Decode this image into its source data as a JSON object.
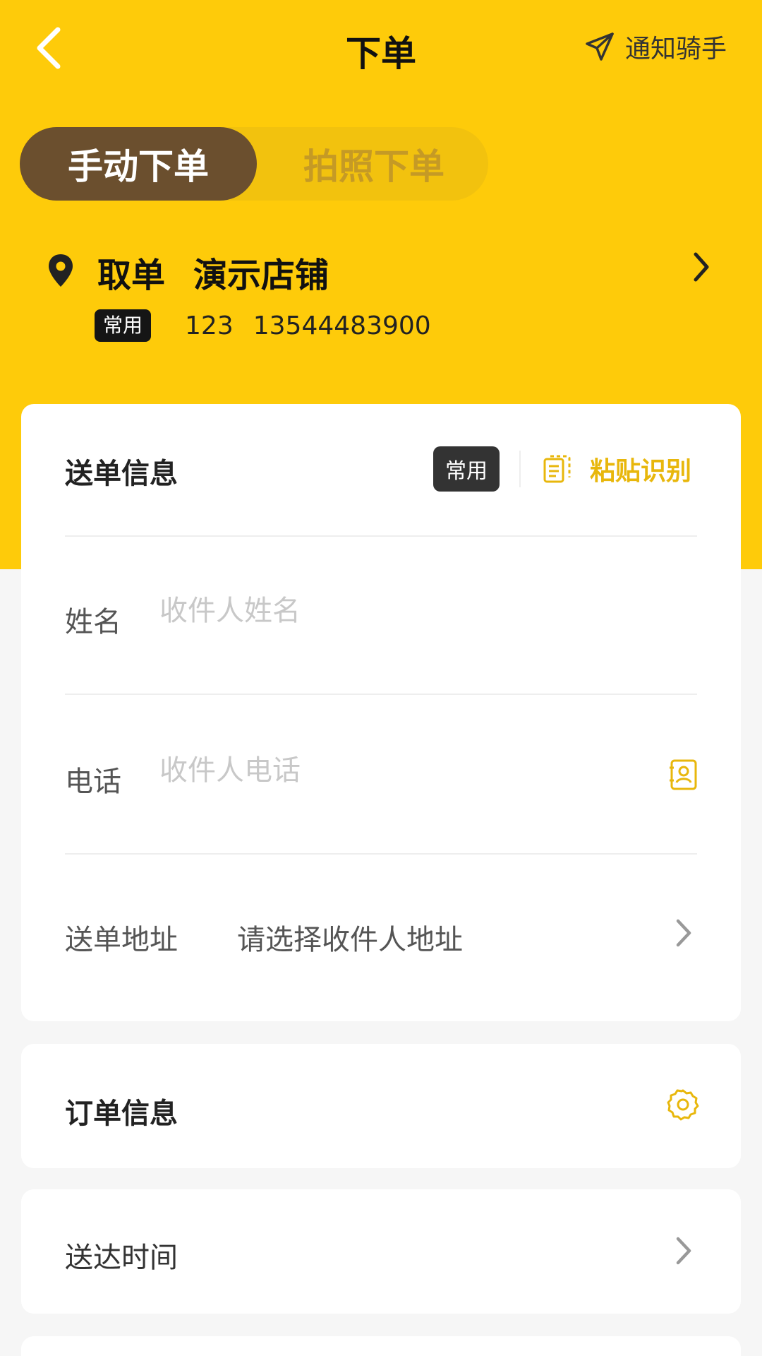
{
  "header": {
    "title": "下单",
    "notify_label": "通知骑手"
  },
  "mode_tabs": [
    {
      "label": "手动下单",
      "active": true
    },
    {
      "label": "拍照下单",
      "active": false
    }
  ],
  "pickup": {
    "type_label": "取单",
    "store_name": "演示店铺",
    "tag": "常用",
    "contact_name": "123",
    "phone": "13544483900"
  },
  "delivery": {
    "section_title": "送单信息",
    "common_tag": "常用",
    "paste_label": "粘贴识别",
    "name_label": "姓名",
    "name_placeholder": "收件人姓名",
    "phone_label": "电话",
    "phone_placeholder": "收件人电话",
    "address_label": "送单地址",
    "address_value": "请选择收件人地址"
  },
  "order": {
    "section_title": "订单信息"
  },
  "delivery_time": {
    "label": "送达时间"
  },
  "colors": {
    "brand_yellow": "#fecb0a",
    "active_tab": "#6b4f2e",
    "accent": "#e8b70c"
  },
  "icons": [
    "back-arrow-icon",
    "paper-plane-icon",
    "location-pin-icon",
    "chevron-right-icon",
    "clipboard-icon",
    "contact-book-icon",
    "gear-icon"
  ]
}
